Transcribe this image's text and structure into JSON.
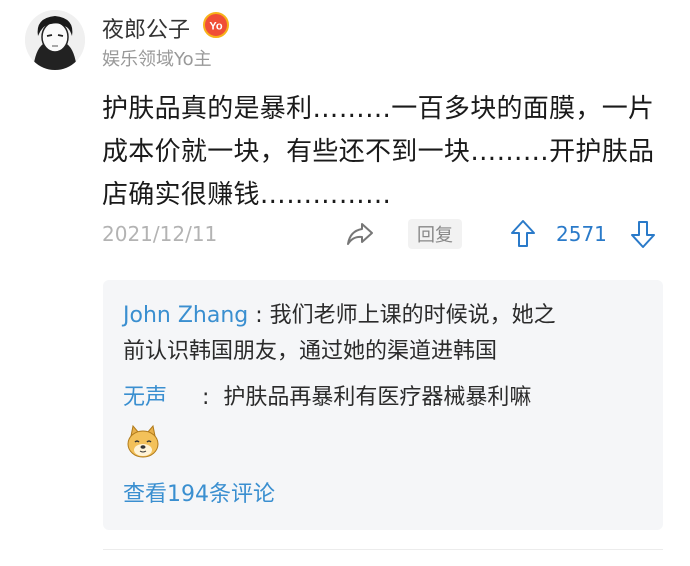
{
  "user": {
    "name": "夜郎公子",
    "badge": "Yo",
    "tag": "娱乐领域Yo主"
  },
  "post": {
    "lines": [
      "护肤品真的是暴利………一百多块的面膜，一片",
      "成本价就一块，有些还不到一块………开护肤品",
      "店确实很赚钱……………"
    ],
    "date": "2021/12/11",
    "reply_label": "回复",
    "vote_count": "2571"
  },
  "replies": [
    {
      "author": "John Zhang",
      "separator": " : ",
      "lines": [
        "我们老师上课的时候说，她之",
        "前认识韩国朋友，通过她的渠道进韩国"
      ]
    },
    {
      "author": "无声",
      "separator": "     :  ",
      "lines": [
        "护肤品再暴利有医疗器械暴利嘛"
      ]
    }
  ],
  "view_more": "查看194条评论",
  "colors": {
    "accent": "#3a8fd0",
    "vote": "#2a7ac9",
    "badge": "#f04e37"
  }
}
